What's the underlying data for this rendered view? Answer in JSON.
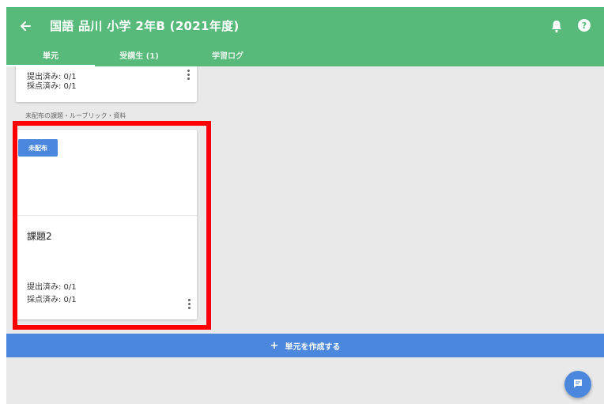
{
  "header": {
    "title": "国語 品川 小学 2年B (2021年度)",
    "back_icon": "arrow-left-icon",
    "bell_icon": "bell-icon",
    "help_icon": "help-icon"
  },
  "tabs": [
    {
      "label": "単元",
      "active": true
    },
    {
      "label": "受講生 (1)",
      "active": false
    },
    {
      "label": "学習ログ",
      "active": false
    }
  ],
  "top_card": {
    "submitted": "提出済み: 0/1",
    "graded": "採点済み: 0/1"
  },
  "section_label": "未配布の課題・ルーブリック・資料",
  "task_card": {
    "badge": "未配布",
    "title": "課題2",
    "submitted": "提出済み: 0/1",
    "graded": "採点済み: 0/1"
  },
  "create_button": {
    "plus": "+",
    "label": "単元を作成する"
  },
  "colors": {
    "header_green": "#57b97a",
    "accent_blue": "#4a87dd",
    "highlight_red": "#ff0000",
    "background": "#e9e9e9"
  }
}
